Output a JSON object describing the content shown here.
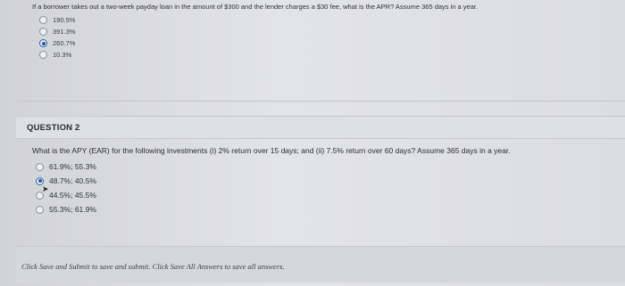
{
  "question1": {
    "prompt": "If a borrower takes out a two-week payday loan in the amount of $300 and the lender charges a $30 fee, what is the APR? Assume 365 days in a year.",
    "options": [
      {
        "label": "190.5%",
        "selected": false
      },
      {
        "label": "391.3%",
        "selected": false
      },
      {
        "label": "260.7%",
        "selected": true
      },
      {
        "label": "10.3%",
        "selected": false
      }
    ]
  },
  "question2": {
    "title": "QUESTION 2",
    "prompt": "What is the APY (EAR) for the following investments (i) 2% return over 15 days; and (ii) 7.5% return over 60 days? Assume 365 days in a year.",
    "options": [
      {
        "label": "61.9%; 55.3%",
        "selected": false
      },
      {
        "label": "48.7%; 40.5%",
        "selected": true
      },
      {
        "label": "44.5%; 45.5%",
        "selected": false
      },
      {
        "label": "55.3%; 61.9%",
        "selected": false
      }
    ]
  },
  "footer": {
    "text": "Click Save and Submit to save and submit. Click Save All Answers to save all answers."
  }
}
